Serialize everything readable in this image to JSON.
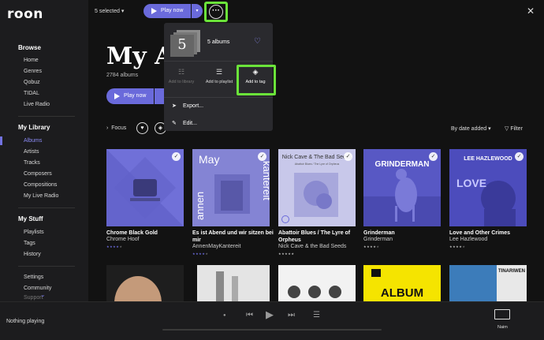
{
  "app": {
    "logo": "roon"
  },
  "sidebar": {
    "browse_title": "Browse",
    "browse_items": [
      "Home",
      "Genres",
      "Qobuz",
      "TIDAL",
      "Live Radio"
    ],
    "library_title": "My Library",
    "library_items": [
      "Albums",
      "Artists",
      "Tracks",
      "Composers",
      "Compositions",
      "My Live Radio"
    ],
    "stuff_title": "My Stuff",
    "stuff_items": [
      "Playlists",
      "Tags",
      "History"
    ],
    "bottom_items": [
      "Settings",
      "Community",
      "Support"
    ]
  },
  "topbar": {
    "selected": "5 selected",
    "play_now": "Play now"
  },
  "page": {
    "title": "My Al",
    "count": "2784 albums",
    "play_now": "Play now",
    "focus": "Focus",
    "sort": "By date added",
    "filter": "Filter"
  },
  "dropdown": {
    "thumb_number": "5",
    "title": "5 albums",
    "actions": [
      {
        "label": "Add to library",
        "icon": "library-add-icon",
        "enabled": false
      },
      {
        "label": "Add to playlist",
        "icon": "playlist-add-icon",
        "enabled": true
      },
      {
        "label": "Add to tag",
        "icon": "tag-icon",
        "enabled": true
      }
    ],
    "rows": [
      {
        "label": "Export...",
        "icon": "export-icon"
      },
      {
        "label": "Edit...",
        "icon": "edit-icon"
      }
    ]
  },
  "albums": [
    {
      "title": "Chrome Black Gold",
      "artist": "Chrome Hoof",
      "rating": 4,
      "art_color": "#7070d8"
    },
    {
      "title": "Es ist Abend und wir sitzen bei mir",
      "artist": "AnnenMayKantereit",
      "rating": 4,
      "art_color": "#8a8ad8"
    },
    {
      "title": "Abattoir Blues / The Lyre of Orpheus",
      "artist": "Nick Cave & the Bad Seeds",
      "rating": 5,
      "art_color": "#b8b8e0"
    },
    {
      "title": "Grinderman",
      "artist": "Grinderman",
      "rating": 4,
      "art_color": "#5a5ac8"
    },
    {
      "title": "Love and Other Crimes",
      "artist": "Lee Hazlewood",
      "rating": 4,
      "art_color": "#5050c0"
    }
  ],
  "album_covers_text": {
    "c2_top": "May",
    "c2_side": "annen",
    "c2_side2": "kantereit",
    "c3_top": "Nick Cave & The Bad Seeds",
    "c3_sub": "Abattoir Blues / The Lyre of Orpheus",
    "c4_top": "GRINDERMAN",
    "c5_top": "LEE HAZLEWOOD",
    "c5_word": "LOVE",
    "row2_c4": "ALBUM",
    "row2_c5": "TINARIWEN"
  },
  "bottom": {
    "now_playing": "Nothing playing",
    "zone": "Naim"
  }
}
